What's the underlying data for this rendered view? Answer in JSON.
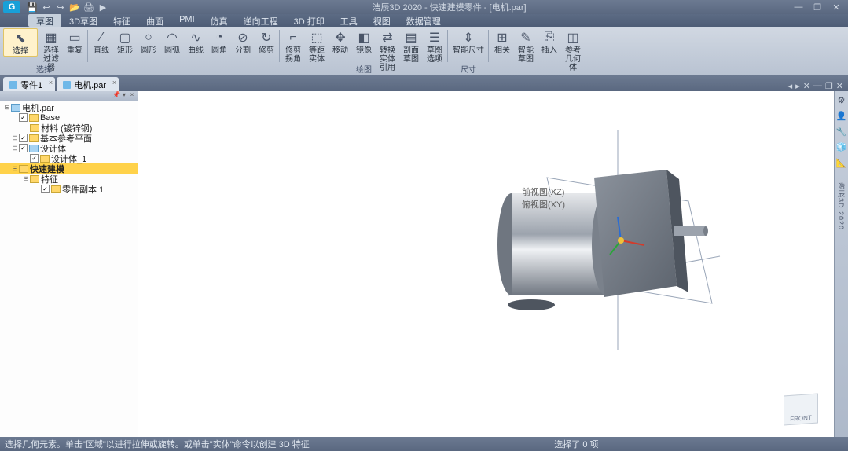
{
  "app": {
    "title": "浩辰3D 2020 - 快速建模零件 - [电机.par]",
    "logo": "G"
  },
  "quick": [
    "💾",
    "↩",
    "↪",
    "📂",
    "🖨",
    "▶"
  ],
  "win": {
    "min": "—",
    "max": "❐",
    "close": "✕",
    "min2": "—",
    "max2": "❐",
    "close2": "✕"
  },
  "menu": {
    "items": [
      "草图",
      "3D草图",
      "特征",
      "曲面",
      "PMI",
      "仿真",
      "逆向工程",
      "3D 打印",
      "工具",
      "视图",
      "数据管理"
    ],
    "active_index": 0
  },
  "ribbon": {
    "groups": [
      {
        "label": "选择",
        "buttons": [
          {
            "name": "select",
            "icon": "⬉",
            "label": "选择",
            "selected": true,
            "wide": true
          },
          {
            "name": "select-filter",
            "icon": "▦",
            "label": "选择过滤器"
          },
          {
            "name": "repeat",
            "icon": "▭",
            "label": "重复"
          }
        ]
      },
      {
        "label": "",
        "buttons": [
          {
            "name": "line",
            "icon": "∕",
            "label": "直线"
          },
          {
            "name": "rect",
            "icon": "▢",
            "label": "矩形"
          },
          {
            "name": "circle",
            "icon": "○",
            "label": "圆形"
          },
          {
            "name": "arc",
            "icon": "◠",
            "label": "圆弧"
          },
          {
            "name": "curve",
            "icon": "∿",
            "label": "曲线"
          },
          {
            "name": "fillet",
            "icon": "◔",
            "label": "圆角"
          },
          {
            "name": "split",
            "icon": "⊘",
            "label": "分割"
          },
          {
            "name": "rotate",
            "icon": "↻",
            "label": "修剪"
          }
        ]
      },
      {
        "label": "绘图",
        "buttons": [
          {
            "name": "trim-corner",
            "icon": "⌐",
            "label": "修剪拐角"
          },
          {
            "name": "offset-solid",
            "icon": "⬚",
            "label": "等距实体"
          },
          {
            "name": "move",
            "icon": "✥",
            "label": "移动"
          },
          {
            "name": "mirror",
            "icon": "◧",
            "label": "镜像"
          },
          {
            "name": "convert-ref",
            "icon": "⇄",
            "label": "转换实体引用"
          },
          {
            "name": "section-sketch",
            "icon": "▤",
            "label": "剖面草图"
          },
          {
            "name": "sketch-options",
            "icon": "☰",
            "label": "草图选项"
          }
        ]
      },
      {
        "label": "尺寸",
        "buttons": [
          {
            "name": "smart-dim",
            "icon": "⇕",
            "label": "智能尺寸",
            "wide": true
          }
        ]
      },
      {
        "label": "",
        "buttons": [
          {
            "name": "relation",
            "icon": "⊞",
            "label": "相关"
          },
          {
            "name": "smart-sketch",
            "icon": "✎",
            "label": "智能草图"
          },
          {
            "name": "insert",
            "icon": "⎘",
            "label": "插入"
          },
          {
            "name": "ref-geom",
            "icon": "◫",
            "label": "参考几何体"
          }
        ]
      }
    ]
  },
  "tabs": [
    {
      "label": "零件1",
      "closable": true
    },
    {
      "label": "电机.par",
      "closable": true
    }
  ],
  "tree": {
    "nodes": [
      {
        "exp": "⊟",
        "cb": false,
        "icon": "blue",
        "label": "电机.par",
        "indent": 0
      },
      {
        "exp": "",
        "cb": true,
        "icon": "",
        "label": "Base",
        "indent": 1
      },
      {
        "exp": "",
        "cb": false,
        "icon": "",
        "label": "材料 (镀锌钢)",
        "indent": 2
      },
      {
        "exp": "⊟",
        "cb": true,
        "icon": "",
        "label": "基本参考平面",
        "indent": 1
      },
      {
        "exp": "⊟",
        "cb": true,
        "icon": "blue",
        "label": "设计体",
        "indent": 1
      },
      {
        "exp": "",
        "cb": true,
        "icon": "",
        "label": "设计体_1",
        "indent": 2
      },
      {
        "exp": "⊟",
        "cb": false,
        "icon": "",
        "label": "快速建模",
        "indent": 1,
        "selected": true
      },
      {
        "exp": "⊟",
        "cb": false,
        "icon": "",
        "label": "特征",
        "indent": 2
      },
      {
        "exp": "",
        "cb": true,
        "icon": "",
        "label": "零件副本 1",
        "indent": 3
      }
    ]
  },
  "viewport": {
    "annot1": "前视图(XZ)",
    "annot2": "俯视图(XY)",
    "viewcube": "FRONT"
  },
  "rightrail": [
    "⚙",
    "👤",
    "🔧",
    "🧊",
    "📐"
  ],
  "rightrail_text": "浩辰3D 2020",
  "status": {
    "left": "选择几何元素。单击\"区域\"以进行拉伸或旋转。或单击\"实体\"命令以创建 3D 特征",
    "mid": "选择了 0 项"
  }
}
